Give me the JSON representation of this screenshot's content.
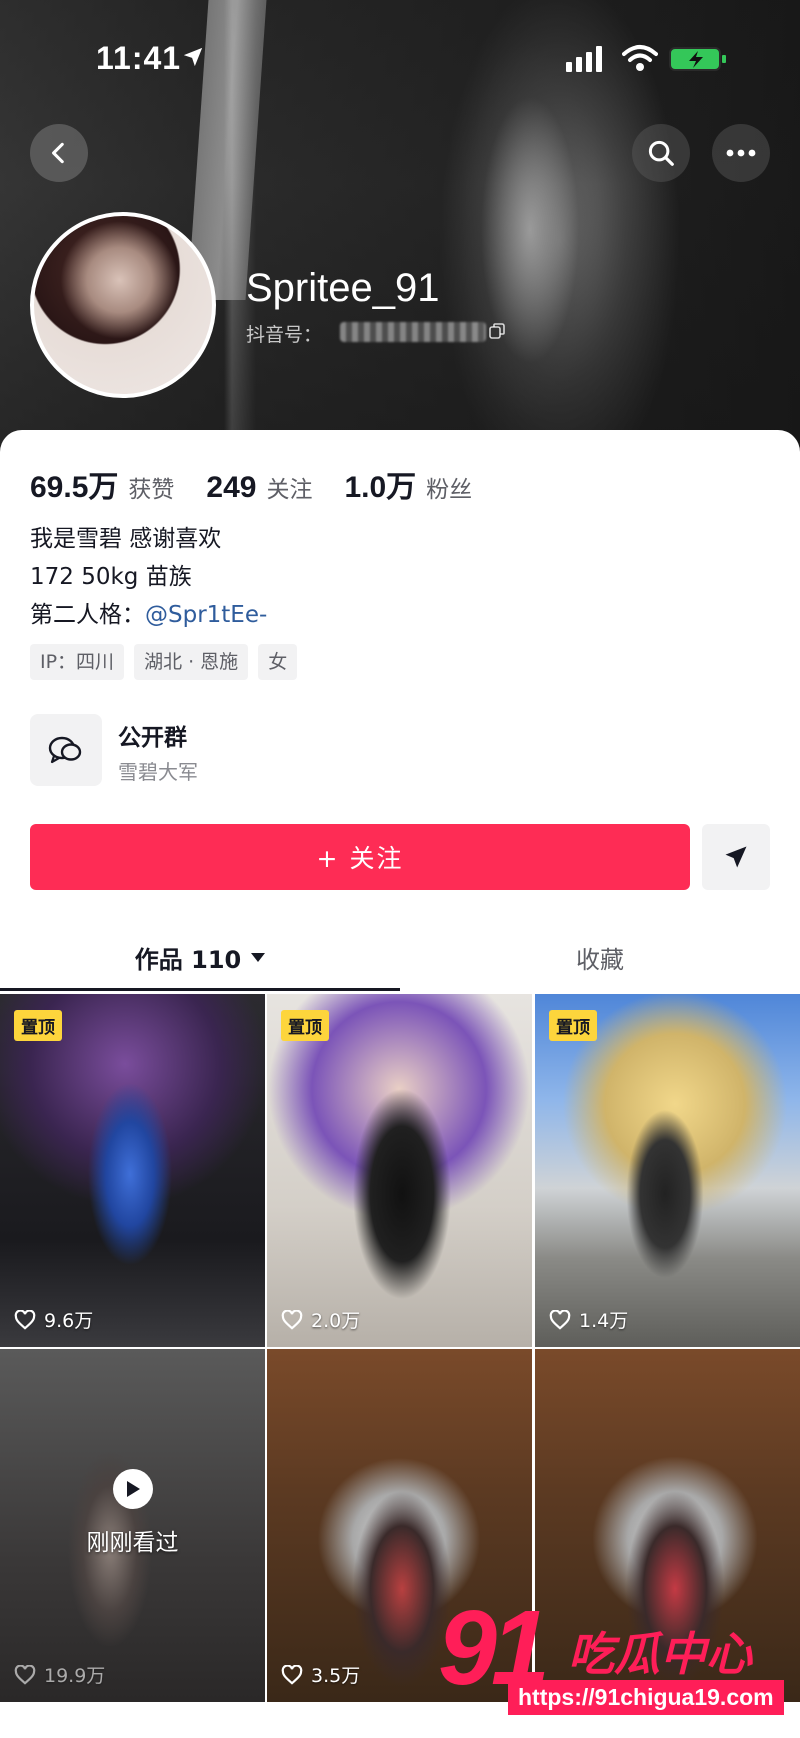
{
  "status_bar": {
    "time": "11:41"
  },
  "profile": {
    "username": "Spritee_91",
    "douyin_id_label": "抖音号：",
    "stats": [
      {
        "value": "69.5万",
        "label": "获赞"
      },
      {
        "value": "249",
        "label": "关注"
      },
      {
        "value": "1.0万",
        "label": "粉丝"
      }
    ],
    "bio_lines": [
      "我是雪碧 感谢喜欢",
      "172 50kg 苗族"
    ],
    "alt_persona_label": "第二人格：",
    "alt_persona_mention": "@Spr1tEe-",
    "tags": [
      "IP：四川",
      "湖北 · 恩施",
      "女"
    ],
    "group": {
      "title": "公开群",
      "subtitle": "雪碧大军"
    },
    "follow_label": "+ 关注"
  },
  "tabs": {
    "works_label": "作品 110",
    "favorites_label": "收藏"
  },
  "videos": [
    {
      "pinned_label": "置顶",
      "likes": "9.6万"
    },
    {
      "pinned_label": "置顶",
      "likes": "2.0万"
    },
    {
      "pinned_label": "置顶",
      "likes": "1.4万"
    },
    {
      "watched_label": "刚刚看过",
      "likes": "19.9万"
    },
    {
      "likes": "3.5万"
    },
    {
      "likes": ""
    }
  ],
  "watermark": {
    "number": "91",
    "name": "吃瓜中心",
    "url": "https://91chigua19.com"
  }
}
